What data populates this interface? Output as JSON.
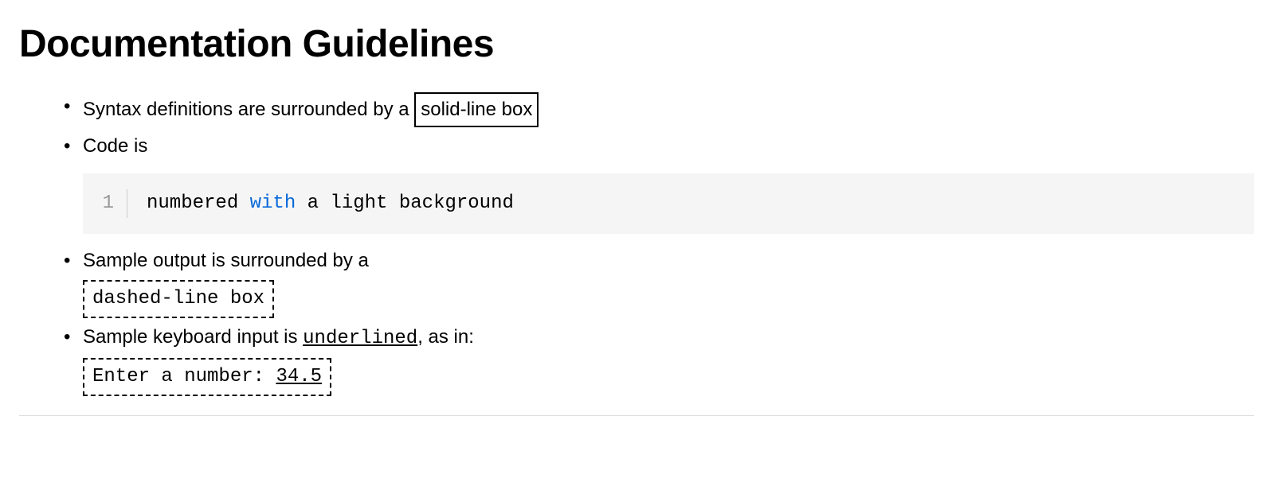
{
  "heading": "Documentation Guidelines",
  "items": {
    "syntax": {
      "prefix": "Syntax definitions are surrounded by a ",
      "box": "solid-line box"
    },
    "code": {
      "label": "Code is",
      "line_number": "1",
      "code_before": "numbered ",
      "code_keyword": "with",
      "code_after": " a light background"
    },
    "output": {
      "prefix": "Sample output is surrounded by a",
      "box": "dashed-line box"
    },
    "input": {
      "prefix": "Sample keyboard input is ",
      "underlined_word": "underlined",
      "suffix": ", as in:",
      "prompt": "Enter a number: ",
      "value": "34.5"
    }
  }
}
